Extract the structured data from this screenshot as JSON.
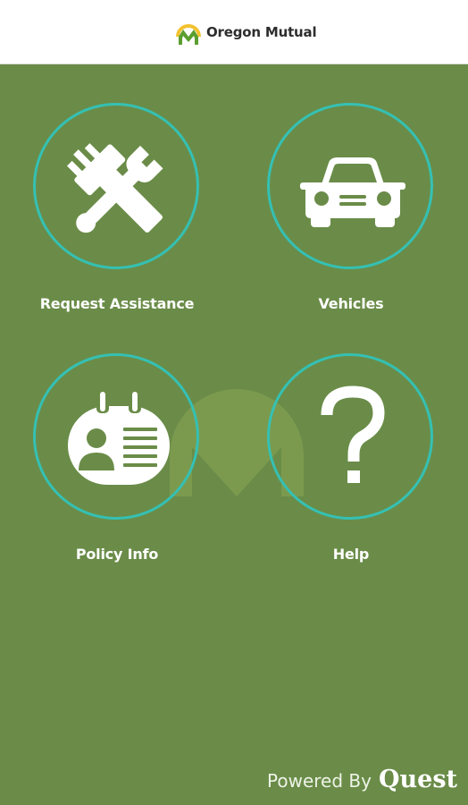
{
  "header": {
    "brand_name": "Oregon Mutual"
  },
  "tiles": [
    {
      "label": "Request Assistance",
      "icon": "tools-icon"
    },
    {
      "label": "Vehicles",
      "icon": "car-icon"
    },
    {
      "label": "Policy Info",
      "icon": "id-card-icon"
    },
    {
      "label": "Help",
      "icon": "question-icon"
    }
  ],
  "footer": {
    "prefix": "Powered By",
    "brand": "Quest"
  },
  "colors": {
    "background": "#6a8c48",
    "header_background": "#ffffff",
    "circle_border": "#35c0b3",
    "icon": "#ffffff",
    "logo_yellow": "#f2c230",
    "logo_green": "#5a9e2f"
  }
}
